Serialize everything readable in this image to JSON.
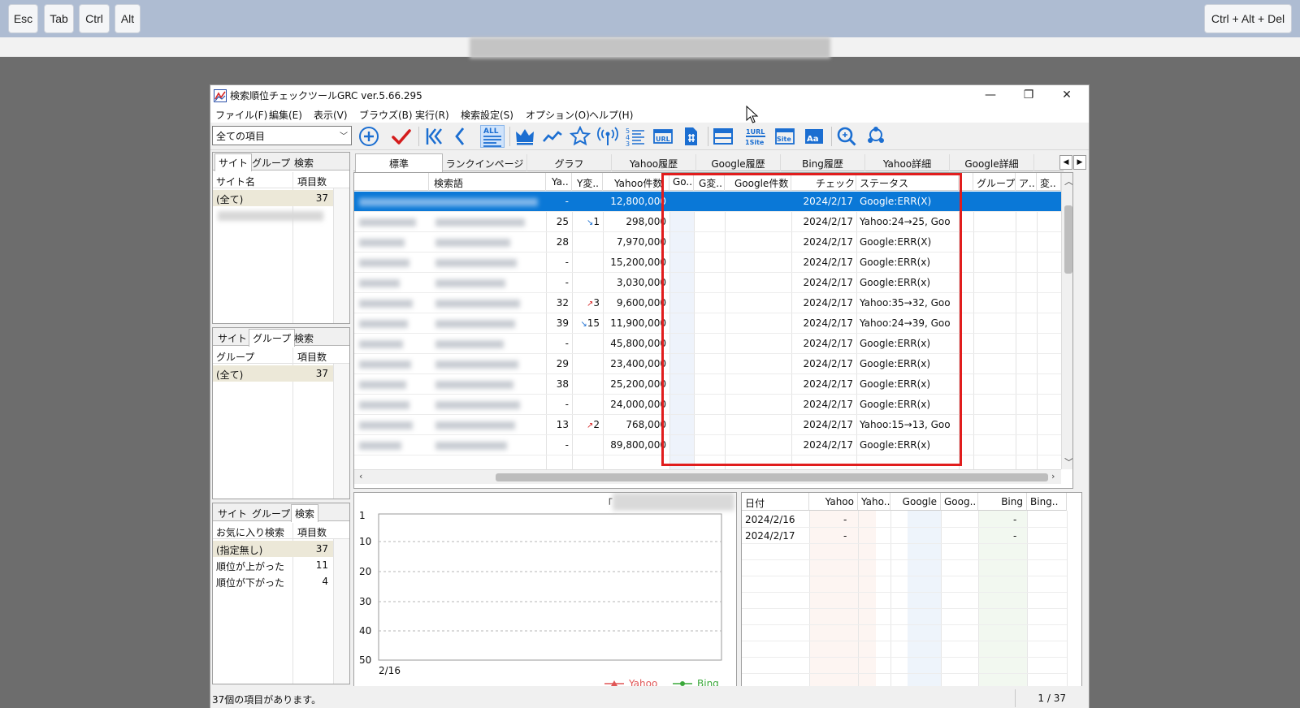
{
  "remote_keys": {
    "esc": "Esc",
    "tab": "Tab",
    "ctrl": "Ctrl",
    "alt": "Alt",
    "cad": "Ctrl + Alt + Del"
  },
  "window": {
    "title": "検索順位チェックツールGRC  ver.5.66.295",
    "minimize": "—",
    "maximize": "❐",
    "close": "✕"
  },
  "menu": [
    "ファイル(F)",
    "編集(E)",
    "表示(V)",
    "ブラウズ(B)",
    "実行(R)",
    "検索設定(S)",
    "オプション(O)",
    "ヘルプ(H)"
  ],
  "toolbar": {
    "filter_combo": "全ての項目",
    "all_label": "ALL",
    "url_label": "URL",
    "oneurl_label": "1URL",
    "onesite_label": "1Site",
    "site_label": "Site",
    "aa_label": "Aa"
  },
  "panel_sites": {
    "tabs": [
      "サイト",
      "グループ",
      "検索"
    ],
    "active_tab": 0,
    "col_name": "サイト名",
    "col_count": "項目数",
    "rows": [
      {
        "name": "(全て)",
        "count": "37"
      }
    ]
  },
  "panel_groups": {
    "tabs": [
      "サイト",
      "グループ",
      "検索"
    ],
    "active_tab": 1,
    "col_name": "グループ",
    "col_count": "項目数",
    "rows": [
      {
        "name": "(全て)",
        "count": "37"
      }
    ]
  },
  "panel_search": {
    "tabs": [
      "サイト",
      "グループ",
      "検索"
    ],
    "active_tab": 2,
    "col_name": "お気に入り検索",
    "col_count": "項目数",
    "rows": [
      {
        "name": "(指定無し)",
        "count": "37"
      },
      {
        "name": "順位が上がった",
        "count": "11"
      },
      {
        "name": "順位が下がった",
        "count": "4"
      }
    ]
  },
  "main_tabs": [
    "標準",
    "ランクインページ",
    "グラフ",
    "Yahoo履歴",
    "Google履歴",
    "Bing履歴",
    "Yahoo詳細",
    "Google詳細"
  ],
  "grid": {
    "headers": {
      "keyword": "検索語",
      "ya": "Ya..",
      "ychg": "Y変..",
      "ycount": "Yahoo件数",
      "go": "Go..",
      "gchg": "G変..",
      "gcount": "Google件数",
      "date": "チェック日",
      "status": "ステータス",
      "group": "グループ",
      "a": "ア..",
      "chg": "変.."
    },
    "rows": [
      {
        "ya": "-",
        "ychg": "",
        "dir": "",
        "ycount": "12,800,000",
        "date": "2024/2/17",
        "status": "Google:ERR(X)"
      },
      {
        "ya": "25",
        "ychg": "1",
        "dir": "down",
        "ycount": "298,000",
        "date": "2024/2/17",
        "status": "Yahoo:24→25, Goo"
      },
      {
        "ya": "28",
        "ychg": "",
        "dir": "",
        "ycount": "7,970,000",
        "date": "2024/2/17",
        "status": "Google:ERR(X)"
      },
      {
        "ya": "-",
        "ychg": "",
        "dir": "",
        "ycount": "15,200,000",
        "date": "2024/2/17",
        "status": "Google:ERR(x)"
      },
      {
        "ya": "-",
        "ychg": "",
        "dir": "",
        "ycount": "3,030,000",
        "date": "2024/2/17",
        "status": "Google:ERR(x)"
      },
      {
        "ya": "32",
        "ychg": "3",
        "dir": "up",
        "ycount": "9,600,000",
        "date": "2024/2/17",
        "status": "Yahoo:35→32, Goo"
      },
      {
        "ya": "39",
        "ychg": "15",
        "dir": "down",
        "ycount": "11,900,000",
        "date": "2024/2/17",
        "status": "Yahoo:24→39, Goo"
      },
      {
        "ya": "-",
        "ychg": "",
        "dir": "",
        "ycount": "45,800,000",
        "date": "2024/2/17",
        "status": "Google:ERR(x)"
      },
      {
        "ya": "29",
        "ychg": "",
        "dir": "",
        "ycount": "23,400,000",
        "date": "2024/2/17",
        "status": "Google:ERR(x)"
      },
      {
        "ya": "38",
        "ychg": "",
        "dir": "",
        "ycount": "25,200,000",
        "date": "2024/2/17",
        "status": "Google:ERR(x)"
      },
      {
        "ya": "-",
        "ychg": "",
        "dir": "",
        "ycount": "24,000,000",
        "date": "2024/2/17",
        "status": "Google:ERR(x)"
      },
      {
        "ya": "13",
        "ychg": "2",
        "dir": "up",
        "ycount": "768,000",
        "date": "2024/2/17",
        "status": "Yahoo:15→13, Goo"
      },
      {
        "ya": "-",
        "ychg": "",
        "dir": "",
        "ycount": "89,800,000",
        "date": "2024/2/17",
        "status": "Google:ERR(x)"
      }
    ],
    "arrows": {
      "up": "↗",
      "down": "↘"
    }
  },
  "chart": {
    "title_prefix": "「",
    "y_ticks": [
      "1",
      "10",
      "20",
      "30",
      "40",
      "50"
    ],
    "x_label": "2/16",
    "legend_yahoo": "Yahoo",
    "legend_bing": "Bing",
    "colors": {
      "yahoo": "#e05656",
      "bing": "#3aa83a"
    }
  },
  "history": {
    "headers": [
      "日付",
      "Yahoo",
      "Yaho..",
      "Google",
      "Goog..",
      "Bing",
      "Bing.."
    ],
    "rows": [
      {
        "date": "2024/2/16",
        "yahoo": "-",
        "bing": "-"
      },
      {
        "date": "2024/2/17",
        "yahoo": "-",
        "bing": "-"
      }
    ]
  },
  "status_bar": {
    "message": "37個の項目があります。",
    "page": "1 / 37"
  }
}
